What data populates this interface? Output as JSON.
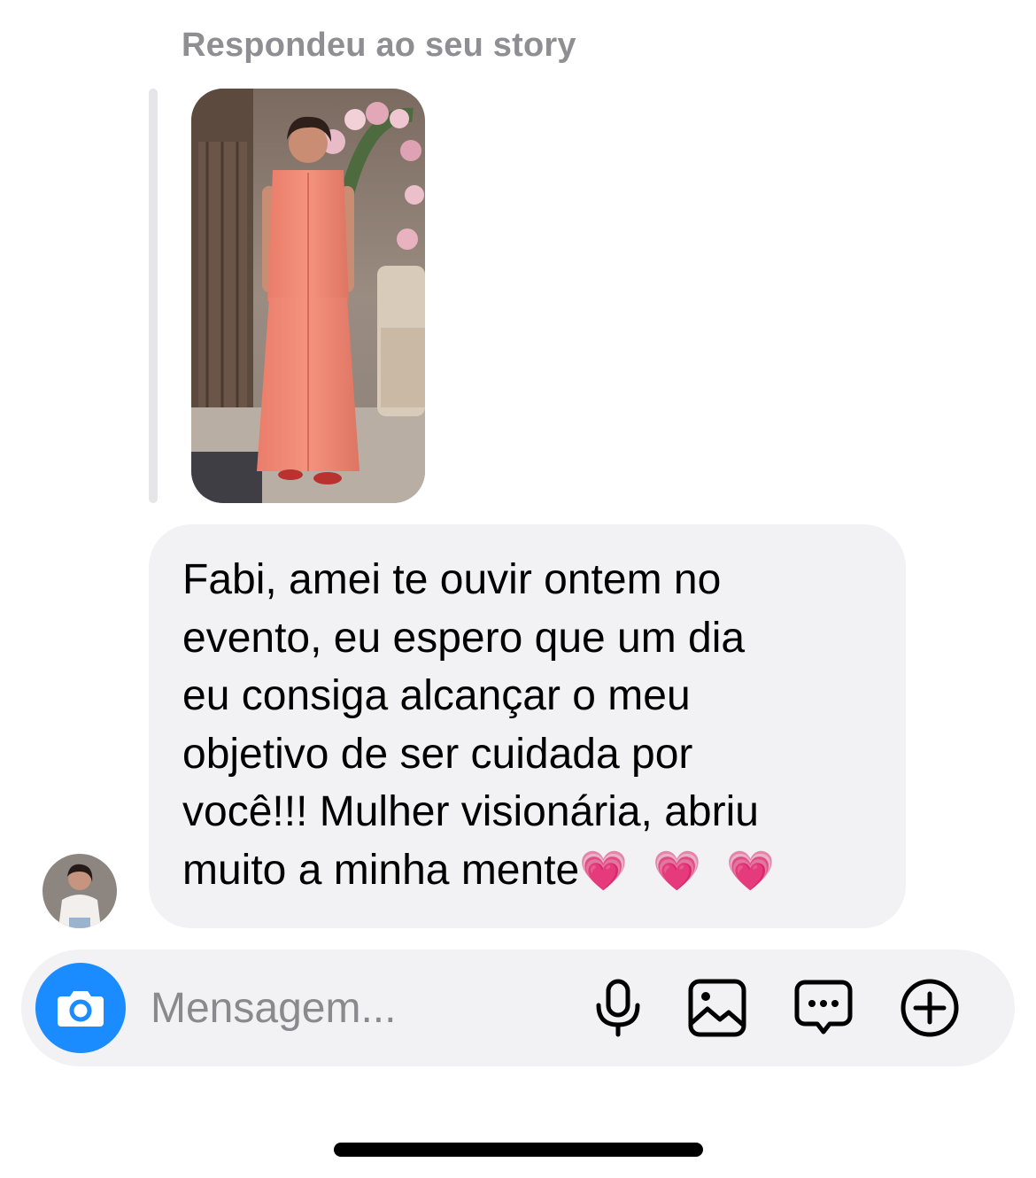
{
  "thread": {
    "reply_context": "Respondeu ao seu story",
    "story": {
      "image": "story-photo-woman-coral-dress"
    },
    "message": {
      "lines": [
        "Fabi, amei te ouvir ontem no",
        "evento, eu espero que um dia",
        "eu consiga alcançar o meu",
        "objetivo de ser cuidada por",
        "você!!! Mulher visionária, abriu",
        "muito a minha mente"
      ],
      "emoji": "💗 💗 💗"
    },
    "sender_avatar": "avatar"
  },
  "composer": {
    "placeholder": "Mensagem...",
    "camera_icon": "camera-icon",
    "actions": [
      "microphone-icon",
      "gallery-icon",
      "sticker-chat-icon",
      "add-plus-icon"
    ],
    "accent_color": "#1a8cff"
  }
}
